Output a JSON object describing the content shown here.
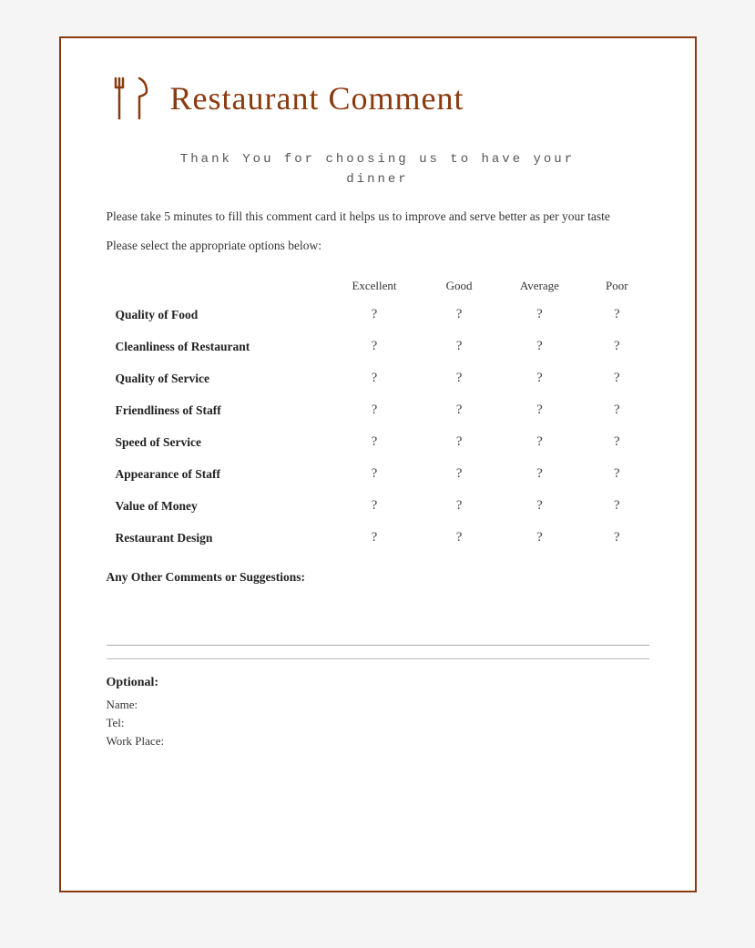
{
  "header": {
    "title": "Restaurant Comment",
    "icon_name": "fork-knife-icon"
  },
  "thank_you": {
    "line1": "Thank You for choosing us to have your",
    "line2": "dinner"
  },
  "description": "Please take 5 minutes to fill this comment card it helps us to improve and serve better as per your taste",
  "instruction": "Please select the appropriate options below:",
  "table": {
    "columns": [
      "",
      "Excellent",
      "Good",
      "Average",
      "Poor"
    ],
    "rows": [
      {
        "label": "Quality of Food",
        "values": [
          "?",
          "?",
          "?",
          "?"
        ]
      },
      {
        "label": "Cleanliness of Restaurant",
        "values": [
          "?",
          "?",
          "?",
          "?"
        ]
      },
      {
        "label": "Quality of Service",
        "values": [
          "?",
          "?",
          "?",
          "?"
        ]
      },
      {
        "label": "Friendliness of Staff",
        "values": [
          "?",
          "?",
          "?",
          "?"
        ]
      },
      {
        "label": "Speed of Service",
        "values": [
          "?",
          "?",
          "?",
          "?"
        ]
      },
      {
        "label": "Appearance of Staff",
        "values": [
          "?",
          "?",
          "?",
          "?"
        ]
      },
      {
        "label": "Value of Money",
        "values": [
          "?",
          "?",
          "?",
          "?"
        ]
      },
      {
        "label": "Restaurant Design",
        "values": [
          "?",
          "?",
          "?",
          "?"
        ]
      }
    ]
  },
  "comments_section": {
    "label": "Any Other Comments or Suggestions:"
  },
  "optional_section": {
    "title": "Optional:",
    "fields": [
      "Name:",
      "Tel:",
      "Work Place:"
    ]
  }
}
